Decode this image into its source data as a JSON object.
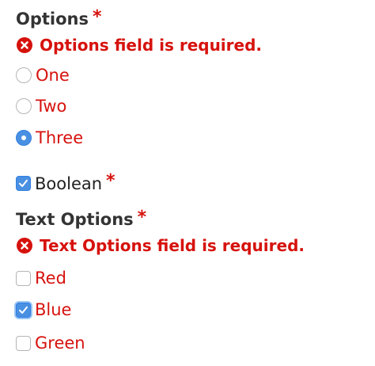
{
  "options_group": {
    "label": "Options",
    "required_mark": "*",
    "error": "Options field is required.",
    "items": [
      {
        "label": "One",
        "checked": false
      },
      {
        "label": "Two",
        "checked": false
      },
      {
        "label": "Three",
        "checked": true
      }
    ]
  },
  "boolean_field": {
    "label": "Boolean",
    "required_mark": "*",
    "checked": true
  },
  "text_options_group": {
    "label": "Text Options",
    "required_mark": "*",
    "error": "Text Options field is required.",
    "items": [
      {
        "label": "Red",
        "checked": false
      },
      {
        "label": "Blue",
        "checked": true
      },
      {
        "label": "Green",
        "checked": false
      }
    ]
  },
  "colors": {
    "error_red": "#d6120d",
    "accent_blue": "#4a90e2",
    "label_text": "#333333"
  }
}
